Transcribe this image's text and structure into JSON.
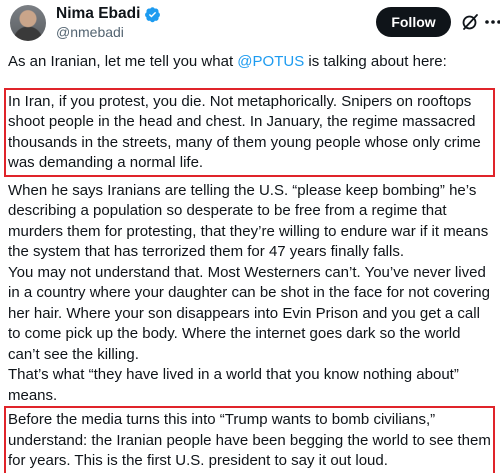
{
  "author": {
    "display_name": "Nima Ebadi",
    "handle": "@nmebadi",
    "verified": true,
    "avatar": "profile-photo"
  },
  "actions": {
    "follow_label": "Follow",
    "grok_icon": "grok-slash-icon",
    "more_icon": "more-dots-icon"
  },
  "tweet": {
    "lead_prefix": "As an Iranian, let me tell you what ",
    "lead_mention": "@POTUS",
    "lead_suffix": " is talking about here:",
    "paragraphs": [
      "In Iran, if you protest, you die. Not metaphorically. Snipers on rooftops shoot people in the head and chest. In January, the regime massacred thousands in the streets, many of them young people whose only crime was demanding a normal life.",
      "When he says Iranians are telling the U.S. “please keep bombing” he’s describing a population so desperate to be free from a regime that murders them for protesting, that they’re willing to endure war if it means the system that has terrorized them for 47 years finally falls.",
      "You may not understand that. Most Westerners can’t. You’ve never lived in a country where your daughter can be shot in the face for not covering her hair. Where your son disappears into Evin Prison and you get a call to come pick up the body. Where the internet goes dark so the world can’t see the killing.",
      "That’s what “they have lived in a world that you know nothing about” means.",
      "Before the media turns this into “Trump wants to bomb civilians,” understand: the Iranian people have been begging the world to see them for years. This is the first U.S. president to say it out loud."
    ],
    "highlight_color": "#e0242a",
    "mention_color": "#1d9bf0"
  }
}
